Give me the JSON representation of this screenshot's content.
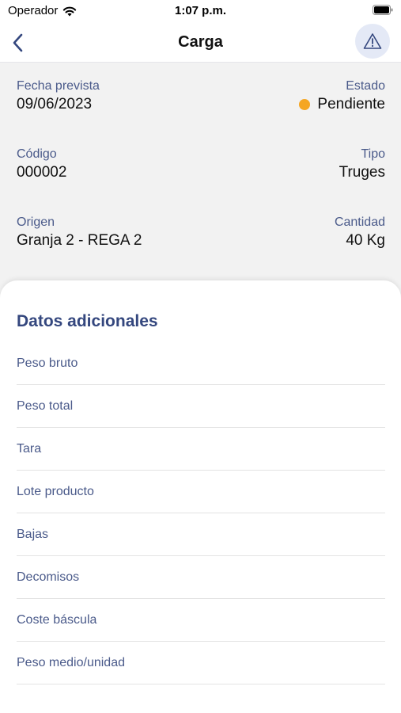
{
  "status_bar": {
    "carrier": "Operador",
    "time": "1:07 p.m."
  },
  "nav": {
    "title": "Carga",
    "back_icon": "chevron-left-icon",
    "alert_icon": "warning-triangle-icon"
  },
  "summary": {
    "fecha_prevista": {
      "label": "Fecha prevista",
      "value": "09/06/2023"
    },
    "estado": {
      "label": "Estado",
      "value": "Pendiente",
      "dot_color": "#f5a623"
    },
    "codigo": {
      "label": "Código",
      "value": "000002"
    },
    "tipo": {
      "label": "Tipo",
      "value": "Truges"
    },
    "origen": {
      "label": "Origen",
      "value": "Granja 2 - REGA 2"
    },
    "cantidad": {
      "label": "Cantidad",
      "value": "40 Kg"
    }
  },
  "additional": {
    "title": "Datos adicionales",
    "items": [
      "Peso bruto",
      "Peso total",
      "Tara",
      "Lote producto",
      "Bajas",
      "Decomisos",
      "Coste báscula",
      "Peso medio/unidad"
    ]
  },
  "colors": {
    "accent": "#34477e",
    "label": "#4a5a8a",
    "summary_bg": "#f2f2f2",
    "alert_button_bg": "#e4e9f6"
  }
}
